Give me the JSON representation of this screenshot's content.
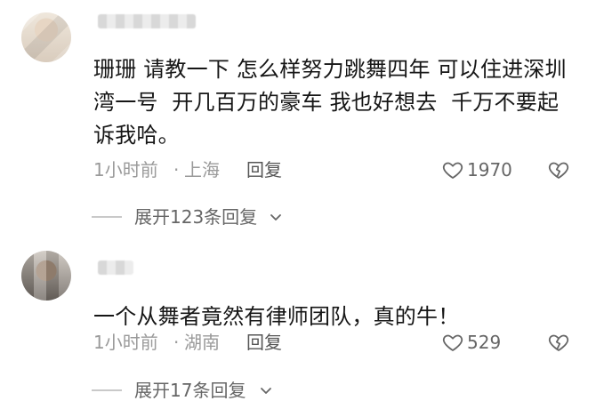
{
  "comments": [
    {
      "text": "珊珊 请教一下 怎么样努力跳舞四年 可以住进深圳湾一号  开几百万的豪车 我也好想去  千万不要起诉我哈。",
      "time": "1小时前",
      "separator": "·",
      "location": "上海",
      "reply_label": "回复",
      "likes": "1970",
      "expand_label": "展开123条回复"
    },
    {
      "text": "一个从舞者竟然有律师团队，真的牛！",
      "time": "1小时前",
      "separator": "·",
      "location": "湖南",
      "reply_label": "回复",
      "likes": "529",
      "expand_label": "展开17条回复"
    }
  ],
  "icons": {
    "like": "heart-outline-icon",
    "dislike": "broken-heart-icon",
    "expand": "chevron-down-icon"
  },
  "colors": {
    "text_primary": "#161616",
    "text_secondary": "#9a9a9a",
    "divider": "#c9c9c9"
  }
}
